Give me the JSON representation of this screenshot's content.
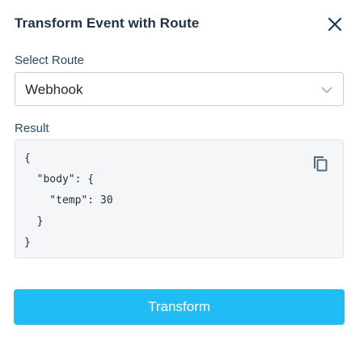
{
  "dialog": {
    "title": "Transform Event with Route",
    "close_icon": "close-icon"
  },
  "route_select": {
    "label": "Select Route",
    "selected_value": "Webhook",
    "icon": "chevron-down-icon"
  },
  "result": {
    "label": "Result",
    "code": "{\n  \"body\": {\n    \"temp\": 30\n  }\n}",
    "copy_icon": "copy-icon"
  },
  "actions": {
    "transform_label": "Transform"
  },
  "colors": {
    "accent": "#1fbdf4",
    "title_text": "#1f3145",
    "code_background": "#f4f6f8"
  }
}
